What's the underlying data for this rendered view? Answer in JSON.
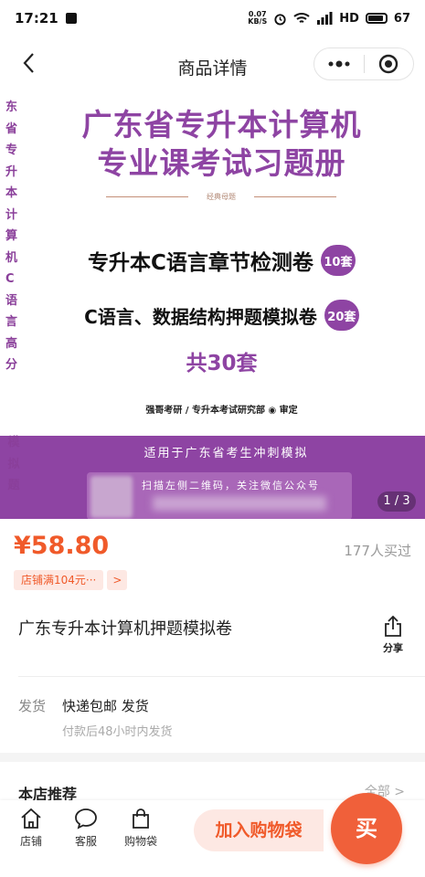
{
  "status_bar": {
    "time": "17:21",
    "net_speed_value": "0.07",
    "net_speed_unit": "KB/S",
    "network": "HD",
    "battery": "67"
  },
  "nav": {
    "title": "商品详情"
  },
  "banner": {
    "side_text_upper": [
      "东",
      "省",
      "专",
      "升",
      "本",
      "计",
      "算",
      "机",
      "C",
      "语",
      "言",
      "高",
      "分"
    ],
    "side_text_lower": [
      "模",
      "拟",
      "题"
    ],
    "title_line1": "广东省专升本计算机",
    "title_line2": "专业课考试习题册",
    "small_caption": "经典母题",
    "line1_text": "专升本C语言章节检测卷",
    "line1_badge": "10套",
    "line2_text": "C语言、数据结构押题模拟卷",
    "line2_badge": "20套",
    "total": "共30套",
    "org": "强哥考研 / 专升本考试研究部 ◉ 审定",
    "band_title": "适用于广东省考生冲刺模拟",
    "qr_text": "扫描左侧二维码，关注微信公众号",
    "page_indicator": "1 / 3"
  },
  "price_section": {
    "price": "¥58.80",
    "sold": "177人买过",
    "promo_tag": "店铺满104元···",
    "promo_arrow": ">"
  },
  "product": {
    "title": "广东专升本计算机押题模拟卷",
    "share_label": "分享"
  },
  "shipping": {
    "label": "发货",
    "value": "快递包邮 发货",
    "note": "付款后48小时内发货"
  },
  "recommend": {
    "title": "本店推荐",
    "more": "全部 >"
  },
  "bottom_bar": {
    "store": "店铺",
    "service": "客服",
    "bag": "购物袋",
    "add_cart": "加入购物袋",
    "buy": "买"
  },
  "colors": {
    "accent": "#f05a2a",
    "banner_purple": "#8e44a3"
  }
}
